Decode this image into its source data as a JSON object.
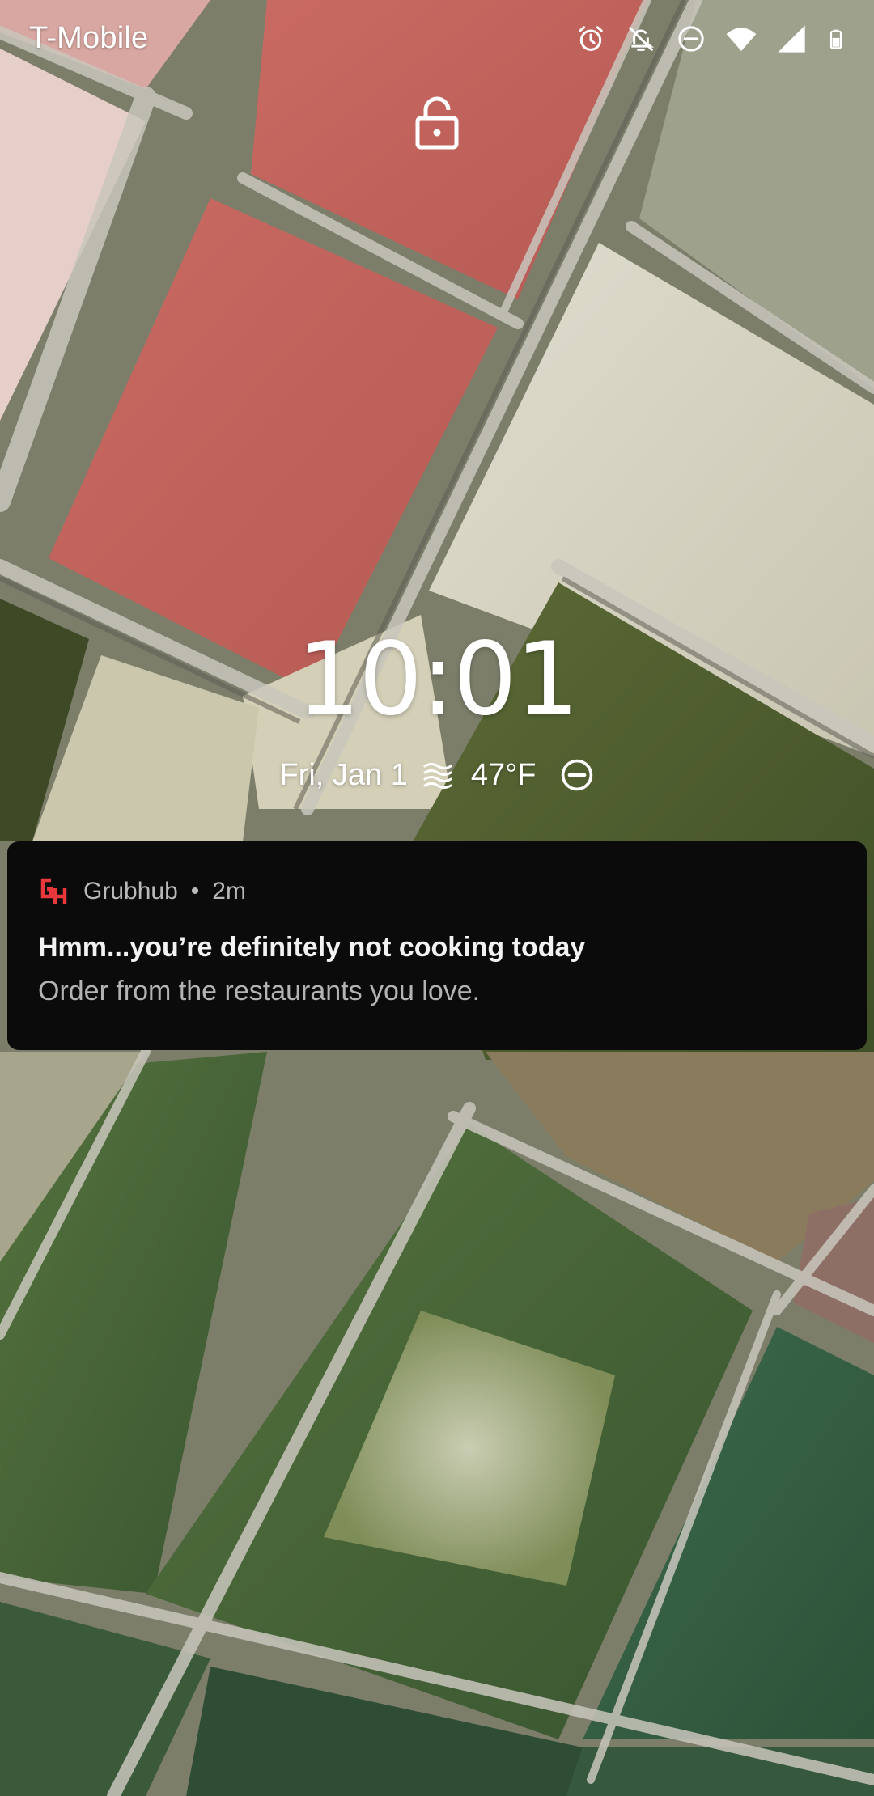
{
  "status_bar": {
    "carrier": "T-Mobile",
    "icons": [
      "alarm-icon",
      "notifications-off-icon",
      "do-not-disturb-icon",
      "wifi-icon",
      "cell-signal-icon",
      "battery-icon"
    ]
  },
  "lock_screen": {
    "lock_icon": "lock-icon",
    "clock": "10:01",
    "date": "Fri, Jan 1",
    "weather_icon": "haze-icon",
    "temperature": "47°F",
    "status_icon": "do-not-disturb-icon"
  },
  "notification": {
    "app_icon": "grubhub-logo-icon",
    "app_name": "Grubhub",
    "separator": "•",
    "time": "2m",
    "title": "Hmm...you’re definitely not cooking today",
    "body": "Order from the restaurants you love.",
    "app_color": "#e8383c"
  }
}
